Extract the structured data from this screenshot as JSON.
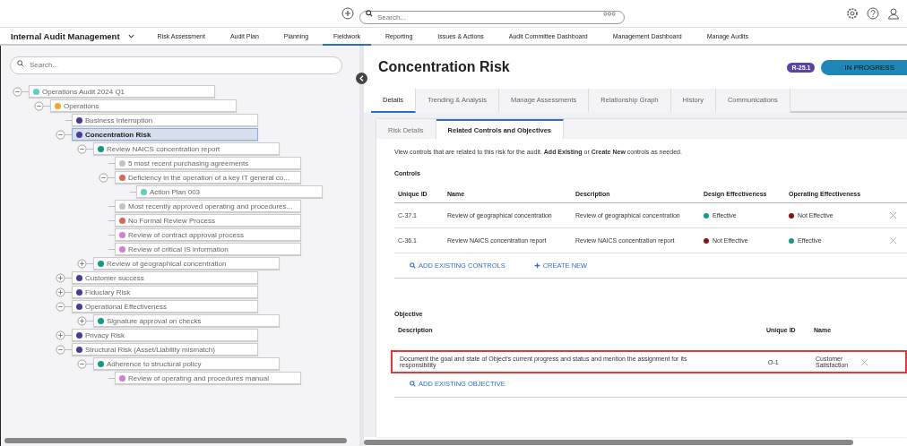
{
  "top_bar": {
    "search": {
      "placeholder": "Search..."
    }
  },
  "nav": {
    "app_name": "Internal Audit Management",
    "tabs": [
      {
        "label": "Risk Assessment",
        "selected": false
      },
      {
        "label": "Audit Plan",
        "selected": false
      },
      {
        "label": "Planning",
        "selected": false
      },
      {
        "label": "Fieldwork",
        "selected": true
      },
      {
        "label": "Reporting",
        "selected": false
      },
      {
        "label": "Issues & Actions",
        "selected": false
      },
      {
        "label": "Audit Committee Dashboard",
        "selected": false
      },
      {
        "label": "Management Dashboard",
        "selected": false
      },
      {
        "label": "Manage Audits",
        "selected": false
      }
    ]
  },
  "tree_panel": {
    "search": {
      "placeholder": "Search..."
    },
    "items": [
      {
        "label": "Operations Audit 2024 Q1",
        "color": "#5fcfc0",
        "expanded": true,
        "selected": false,
        "children": [
          {
            "label": "Operations",
            "color": "#f5a623",
            "expanded": true,
            "selected": false,
            "children": [
              {
                "label": "Business Interruption",
                "color": "#4b3a9e",
                "selected": false
              },
              {
                "label": "Concentration Risk",
                "color": "#4b3a9e",
                "expanded": true,
                "selected": true,
                "children": [
                  {
                    "label": "Review NAICS concentration report",
                    "color": "#0f9d88",
                    "expanded": true,
                    "selected": false,
                    "children": [
                      {
                        "label": "5 most recent purchasing agreements",
                        "color": "#c4c4c4",
                        "selected": false
                      },
                      {
                        "label": "Deficiency in the operation of a key IT general co...",
                        "color": "#d9675f",
                        "expanded": true,
                        "selected": false,
                        "children": [
                          {
                            "label": "Action Plan 003",
                            "color": "#5fcfc0",
                            "selected": false
                          }
                        ]
                      },
                      {
                        "label": "Most recently approved operating and procedures...",
                        "color": "#c4c4c4",
                        "selected": false
                      },
                      {
                        "label": "No Formal Review Process",
                        "color": "#d9675f",
                        "selected": false
                      },
                      {
                        "label": "Review of contract approval process",
                        "color": "#d17fd0",
                        "selected": false
                      },
                      {
                        "label": "Review of critical IS information",
                        "color": "#d17fd0",
                        "selected": false
                      }
                    ]
                  },
                  {
                    "label": "Review of geographical concentration",
                    "color": "#0f9d88",
                    "expanded": false,
                    "selected": false
                  }
                ]
              },
              {
                "label": "Customer success",
                "color": "#4b3a9e",
                "expanded": false,
                "selected": false
              },
              {
                "label": "Fiduciary Risk",
                "color": "#4b3a9e",
                "expanded": false,
                "selected": false
              },
              {
                "label": "Operational Effectiveness",
                "color": "#4b3a9e",
                "expanded": true,
                "selected": false,
                "children": [
                  {
                    "label": "Signature approval on checks",
                    "color": "#0f9d88",
                    "expanded": false,
                    "selected": false
                  }
                ]
              },
              {
                "label": "Privacy Risk",
                "color": "#4b3a9e",
                "expanded": false,
                "selected": false
              },
              {
                "label": "Structural Risk (Asset/Liability mismatch)",
                "color": "#4b3a9e",
                "expanded": true,
                "selected": false,
                "children": [
                  {
                    "label": "Adherence to structural policy",
                    "color": "#0f9d88",
                    "expanded": true,
                    "selected": false,
                    "children": [
                      {
                        "label": "Review of operating and procedures manual",
                        "color": "#d17fd0",
                        "selected": false
                      }
                    ]
                  }
                ]
              }
            ]
          }
        ]
      }
    ]
  },
  "detail": {
    "title": "Concentration Risk",
    "id_badge": "R-25.1",
    "status": "IN PROGRESS",
    "tabs": [
      {
        "label": "Details",
        "selected": true
      },
      {
        "label": "Trending & Analysis",
        "selected": false
      },
      {
        "label": "Manage Assessments",
        "selected": false
      },
      {
        "label": "Relationship Graph",
        "selected": false
      },
      {
        "label": "History",
        "selected": false
      },
      {
        "label": "Communications",
        "selected": false
      }
    ],
    "sub_tabs": [
      {
        "label": "Risk Details",
        "selected": false
      },
      {
        "label": "Related Controls and Objectives",
        "selected": true
      }
    ],
    "intro": "View controls that are related to this risk for the audit. **Add Existing** or **Create New** controls as needed.",
    "controls": {
      "heading": "Controls",
      "columns": [
        "Unique ID",
        "Name",
        "Description",
        "Design Effectiveness",
        "Operating Effectiveness"
      ],
      "rows": [
        {
          "id": "C-37.1",
          "name": "Review of geographical concentration",
          "description": "Review of geographical concentration",
          "design": {
            "text": "Effective",
            "color": "#0f9d88"
          },
          "operating": {
            "text": "Not Effective",
            "color": "#8b1010"
          }
        },
        {
          "id": "C-36.1",
          "name": "Review NAICS concentration report",
          "description": "Review NAICS concentration report",
          "design": {
            "text": "Not Effective",
            "color": "#8b1010"
          },
          "operating": {
            "text": "Effective",
            "color": "#0f9d88"
          }
        }
      ],
      "actions": [
        "ADD EXISTING CONTROLS",
        "CREATE NEW"
      ]
    },
    "objective": {
      "heading": "Objective",
      "columns": [
        "Description",
        "Unique ID",
        "Name"
      ],
      "rows": [
        {
          "description": "Document the goal and state of Object's current progress and status and mention the assignment for its responsibility",
          "id": "O-1",
          "name": "Customer Satisfaction",
          "highlighted": true
        }
      ],
      "action": "ADD EXISTING OBJECTIVE"
    }
  }
}
